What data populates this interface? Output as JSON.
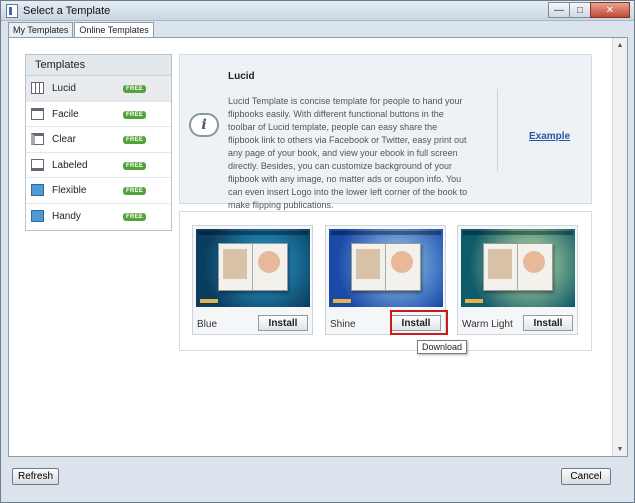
{
  "window": {
    "title": "Select a Template",
    "icon": "app-icon"
  },
  "tabs": [
    {
      "label": "My Templates",
      "active": false
    },
    {
      "label": "Online Templates",
      "active": true
    }
  ],
  "sidebar": {
    "header": "Templates",
    "items": [
      {
        "label": "Lucid",
        "badge": "FREE",
        "thumb": "grid-thumb-icon"
      },
      {
        "label": "Facile",
        "badge": "FREE",
        "thumb": "facile-thumb-icon"
      },
      {
        "label": "Clear",
        "badge": "FREE",
        "thumb": "clear-thumb-icon"
      },
      {
        "label": "Labeled",
        "badge": "FREE",
        "thumb": "labeled-thumb-icon"
      },
      {
        "label": "Flexible",
        "badge": "FREE",
        "thumb": "flexible-thumb-icon"
      },
      {
        "label": "Handy",
        "badge": "FREE",
        "thumb": "handy-thumb-icon"
      }
    ]
  },
  "info": {
    "title": "Lucid",
    "description": "Lucid Template is concise template for people to hand your flipbooks easily. With different functional buttons in the toolbar of Lucid template, people can easy share the flipbook link to others via Facebook or Twitter, easy print out any page of your book, and view your ebook in full screen directly. Besides, you can customize background of your flipbook with any image, no matter ads or coupon info. You can even insert Logo into the lower left corner of the book to make flipping publications.",
    "example_link": "Example"
  },
  "variants": [
    {
      "name": "Blue",
      "install": "Install",
      "bg_from": "#0b3d5e",
      "bg_to": "#2aa3d9"
    },
    {
      "name": "Shine",
      "install": "Install",
      "bg_from": "#1a4aa8",
      "bg_to": "#9fd2f5"
    },
    {
      "name": "Warm Light",
      "install": "Install",
      "bg_from": "#0e5b6b",
      "bg_to": "#cde8a4"
    }
  ],
  "tooltip": "Download",
  "buttons": {
    "refresh": "Refresh",
    "cancel": "Cancel"
  },
  "colors": {
    "highlight": "#cc1a1a",
    "link": "#2a56a6",
    "free_badge": "#55a13a"
  }
}
